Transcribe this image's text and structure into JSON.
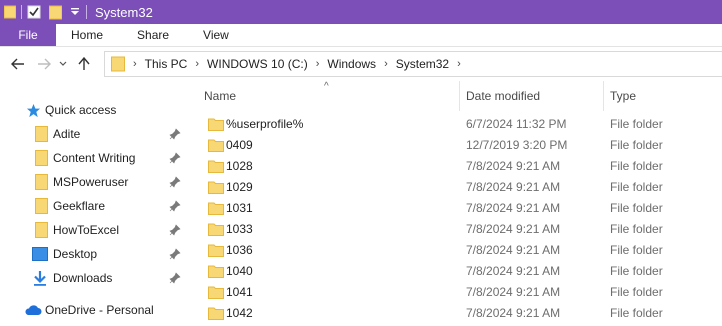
{
  "window": {
    "title": "System32"
  },
  "ribbon": {
    "tabs": [
      "File",
      "Home",
      "Share",
      "View"
    ]
  },
  "address": {
    "crumbs": [
      "This PC",
      "WINDOWS 10 (C:)",
      "Windows",
      "System32"
    ]
  },
  "sidebar": {
    "quick_access": "Quick access",
    "items": [
      {
        "label": "Adite",
        "icon": "folder-icon"
      },
      {
        "label": "Content Writing",
        "icon": "folder-icon"
      },
      {
        "label": "MSPoweruser",
        "icon": "folder-icon"
      },
      {
        "label": "Geekflare",
        "icon": "folder-icon"
      },
      {
        "label": "HowToExcel",
        "icon": "folder-icon"
      },
      {
        "label": "Desktop",
        "icon": "desktop-folder-icon"
      },
      {
        "label": "Downloads",
        "icon": "downloads-icon"
      }
    ],
    "onedrive": "OneDrive - Personal"
  },
  "columns": {
    "name": "Name",
    "date": "Date modified",
    "type": "Type"
  },
  "files": [
    {
      "name": "%userprofile%",
      "date": "6/7/2024 11:32 PM",
      "type": "File folder"
    },
    {
      "name": "0409",
      "date": "12/7/2019 3:20 PM",
      "type": "File folder"
    },
    {
      "name": "1028",
      "date": "7/8/2024 9:21 AM",
      "type": "File folder"
    },
    {
      "name": "1029",
      "date": "7/8/2024 9:21 AM",
      "type": "File folder"
    },
    {
      "name": "1031",
      "date": "7/8/2024 9:21 AM",
      "type": "File folder"
    },
    {
      "name": "1033",
      "date": "7/8/2024 9:21 AM",
      "type": "File folder"
    },
    {
      "name": "1036",
      "date": "7/8/2024 9:21 AM",
      "type": "File folder"
    },
    {
      "name": "1040",
      "date": "7/8/2024 9:21 AM",
      "type": "File folder"
    },
    {
      "name": "1041",
      "date": "7/8/2024 9:21 AM",
      "type": "File folder"
    },
    {
      "name": "1042",
      "date": "7/8/2024 9:21 AM",
      "type": "File folder"
    }
  ],
  "colors": {
    "accent": "#7b4fb7",
    "folder": "#f8d775",
    "folder_dark": "#e6b93d",
    "link_blue": "#1a73e8"
  }
}
